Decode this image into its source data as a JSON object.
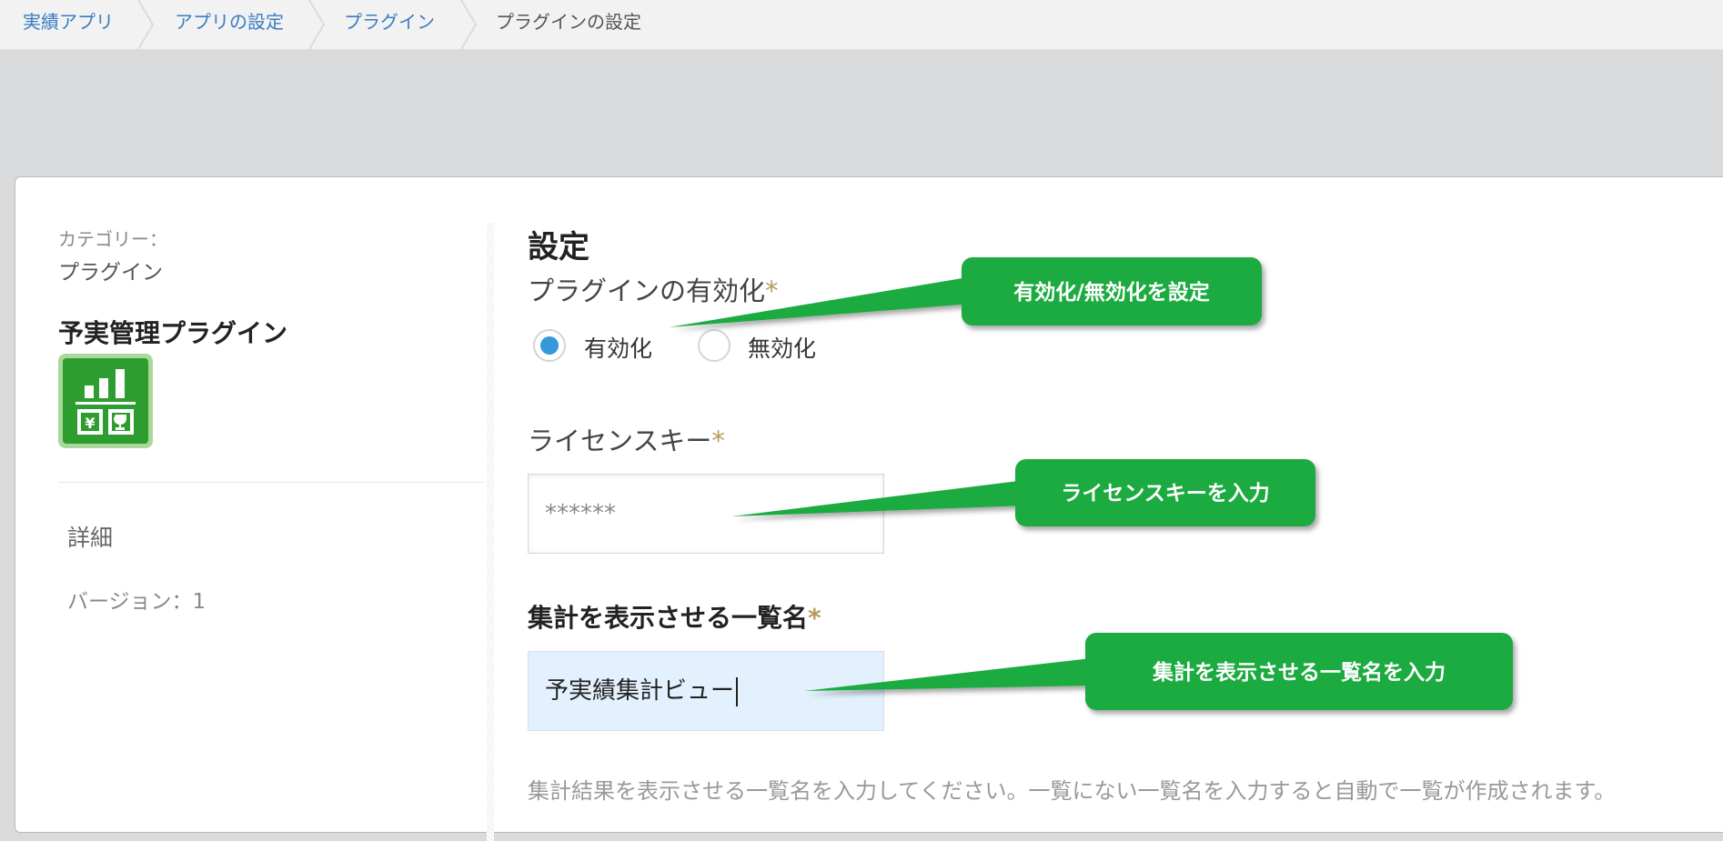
{
  "breadcrumb": {
    "items": [
      "実績アプリ",
      "アプリの設定",
      "プラグイン"
    ],
    "current": "プラグインの設定"
  },
  "sidebar": {
    "category_label": "カテゴリー：",
    "category_value": "プラグイン",
    "plugin_name": "予実管理プラグイン",
    "plugin_icon": "bar-chart-icon",
    "detail_label": "詳細",
    "version": "バージョン：1"
  },
  "settings": {
    "title": "設定",
    "enable": {
      "label": "プラグインの有効化",
      "required": "*",
      "options": [
        "有効化",
        "無効化"
      ],
      "selected": "有効化"
    },
    "license": {
      "label": "ライセンスキー",
      "required": "*",
      "value": "******"
    },
    "view_name": {
      "label": "集計を表示させる一覧名",
      "required": "*",
      "value": "予実績集計ビュー"
    },
    "help_text": "集計結果を表示させる一覧名を入力してください。一覧にない一覧名を入力すると自動で一覧が作成されます。"
  },
  "callouts": [
    "有効化/無効化を設定",
    "ライセンスキーを入力",
    "集計を表示させる一覧名を入力"
  ],
  "colors": {
    "callout": "#1aab3f",
    "link": "#3b7cc2",
    "radio_selected": "#3498db",
    "required_mark": "#b99a5c",
    "active_input": "#e2f1fd"
  }
}
